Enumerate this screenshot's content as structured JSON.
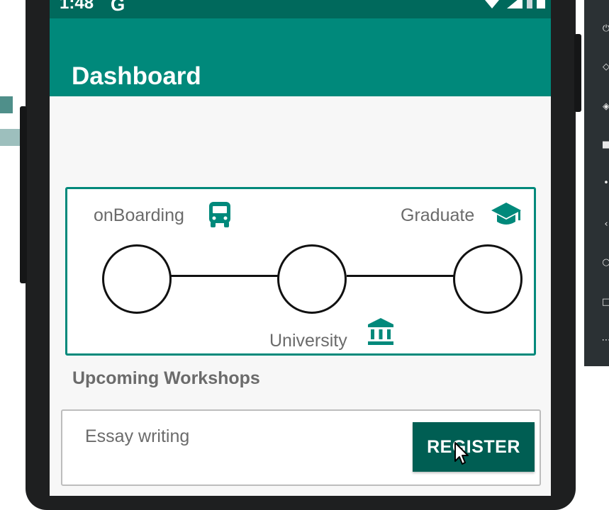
{
  "status_bar": {
    "time": "1:48",
    "google_glyph": "G"
  },
  "app_bar": {
    "title": "Dashboard"
  },
  "progress_tracker": {
    "steps": [
      {
        "label": "onBoarding",
        "icon": "bus-icon"
      },
      {
        "label": "University",
        "icon": "bank-icon"
      },
      {
        "label": "Graduate",
        "icon": "graduation-cap-icon"
      }
    ]
  },
  "workshops": {
    "title": "Upcoming Workshops",
    "items": [
      {
        "name": "Essay writing",
        "action_label": "REGISTER"
      }
    ]
  },
  "colors": {
    "primary": "#00897b",
    "primary_dark": "#00695c",
    "button": "#005e53"
  }
}
